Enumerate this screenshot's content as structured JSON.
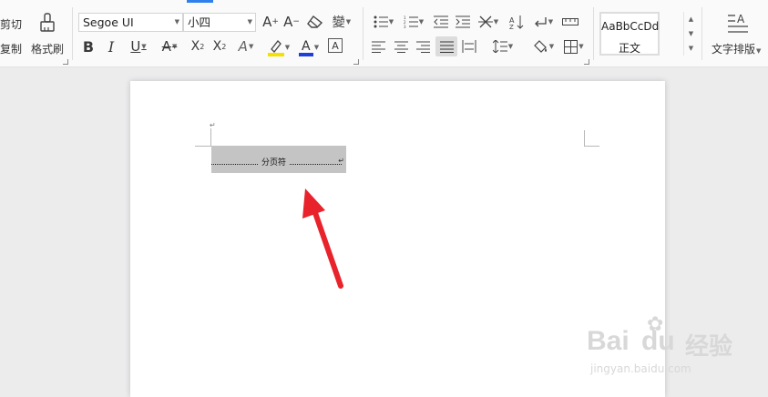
{
  "ribbon": {
    "clipboard": {
      "cut_label": "剪切",
      "copy_label": "复制",
      "format_painter_label": "格式刷"
    },
    "font": {
      "family": "Segoe UI",
      "size": "小四",
      "phonetic_label": "變"
    },
    "styles": {
      "sample": "AaBbCcDd",
      "name": "正文"
    },
    "text_layout_label": "文字排版"
  },
  "document": {
    "page_break_label": "分页符"
  },
  "watermark": {
    "brand": "Bai",
    "brand2": "du",
    "suffix": "经验",
    "url": "jingyan.baidu.com"
  },
  "colors": {
    "accent": "#2f80ed",
    "highlight": "#f5e000",
    "font_color": "#1f3fd8",
    "arrow": "#e8232b"
  }
}
